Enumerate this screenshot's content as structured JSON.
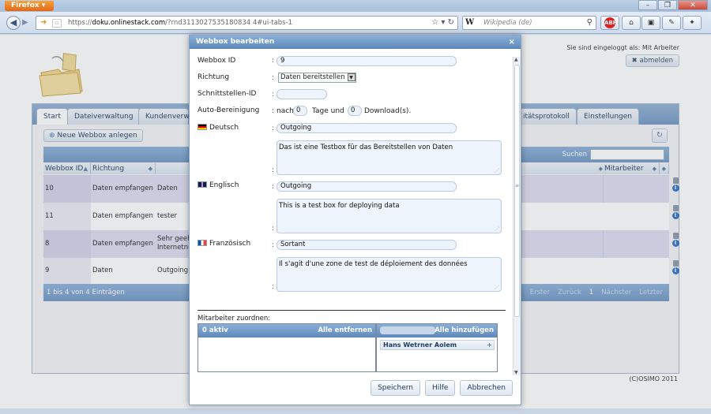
{
  "browser": {
    "app_button": "Firefox",
    "url_domain": "doku.onlinestack.com",
    "url_prefix": "https://",
    "url_path": "/?rnd3113027535180834 4#ui-tabs-1",
    "search_placeholder": "Wikipedia (de)",
    "search_engine_glyph": "W",
    "window_controls": [
      "–",
      "❐",
      "✕"
    ]
  },
  "header": {
    "logged_in_text": "Sie sind eingeloggt als: Mit Arbeiter",
    "logout_label": "abmelden"
  },
  "tabs": [
    "Start",
    "Dateiverwaltung",
    "Kundenverwa",
    "itätsprotokoll",
    "Einstellungen"
  ],
  "toolbar": {
    "new_webbox_label": "Neue Webbox anlegen"
  },
  "table": {
    "search_label": "Suchen",
    "columns": [
      "Webbox ID",
      "Richtung",
      "",
      "",
      "Mitarbeiter"
    ],
    "rows": [
      {
        "id": "10",
        "richtung": "Daten empfangen",
        "desc": "Daten"
      },
      {
        "id": "11",
        "richtung": "Daten empfangen",
        "desc": "tester"
      },
      {
        "id": "8",
        "richtung": "Daten empfangen",
        "desc": "Sehr geeh",
        "desc2": "Internetnu"
      },
      {
        "id": "9",
        "richtung": "Daten bereitstellen",
        "desc": "Outgoing"
      }
    ],
    "count_text": "1 bis 4 von 4 Einträgen",
    "pager": [
      "Erster",
      "Zurück",
      "1",
      "Nächster",
      "Letzter"
    ]
  },
  "copyright": "(C)OSIMO 2011",
  "dialog": {
    "title": "Webbox bearbeiten",
    "close_glyph": "×",
    "labels": {
      "webbox_id": "Webbox ID",
      "richtung": "Richtung",
      "schnittstelle": "Schnittstellen-ID",
      "auto": "Auto-Bereinigung",
      "deutsch": "Deutsch",
      "englisch": "Englisch",
      "franzoesisch": "Französisch"
    },
    "colon": ":",
    "values": {
      "webbox_id": "9",
      "richtung": "Daten bereitstellen",
      "schnittstelle": "",
      "auto_prefix": "nach",
      "auto_days": "0",
      "auto_mid": "Tage und",
      "auto_downloads": "0",
      "auto_suffix": "Download(s).",
      "de_title": "Outgoing",
      "de_text": "Das ist eine Testbox für das Bereitstellen von Daten",
      "en_title": "Outgoing",
      "en_text": "This is a test box for deploying data",
      "fr_title": "Sortant",
      "fr_text": "Il s'agit d'une zone de test de déploiement des données"
    },
    "assign_label": "Mitarbeiter zuordnen:",
    "left_list": {
      "active_label": "0 aktiv",
      "remove_all": "Alle entfernen"
    },
    "right_list": {
      "add_all": "Alle hinzufügen",
      "items": [
        "Hans Wetrner Aolem"
      ]
    },
    "buttons": {
      "save": "Speichern",
      "help": "Hilfe",
      "cancel": "Abbrechen"
    }
  },
  "colors": {
    "accent": "#6d95c3",
    "header": "#5d88bb",
    "row_alt": "#dcdcee"
  }
}
